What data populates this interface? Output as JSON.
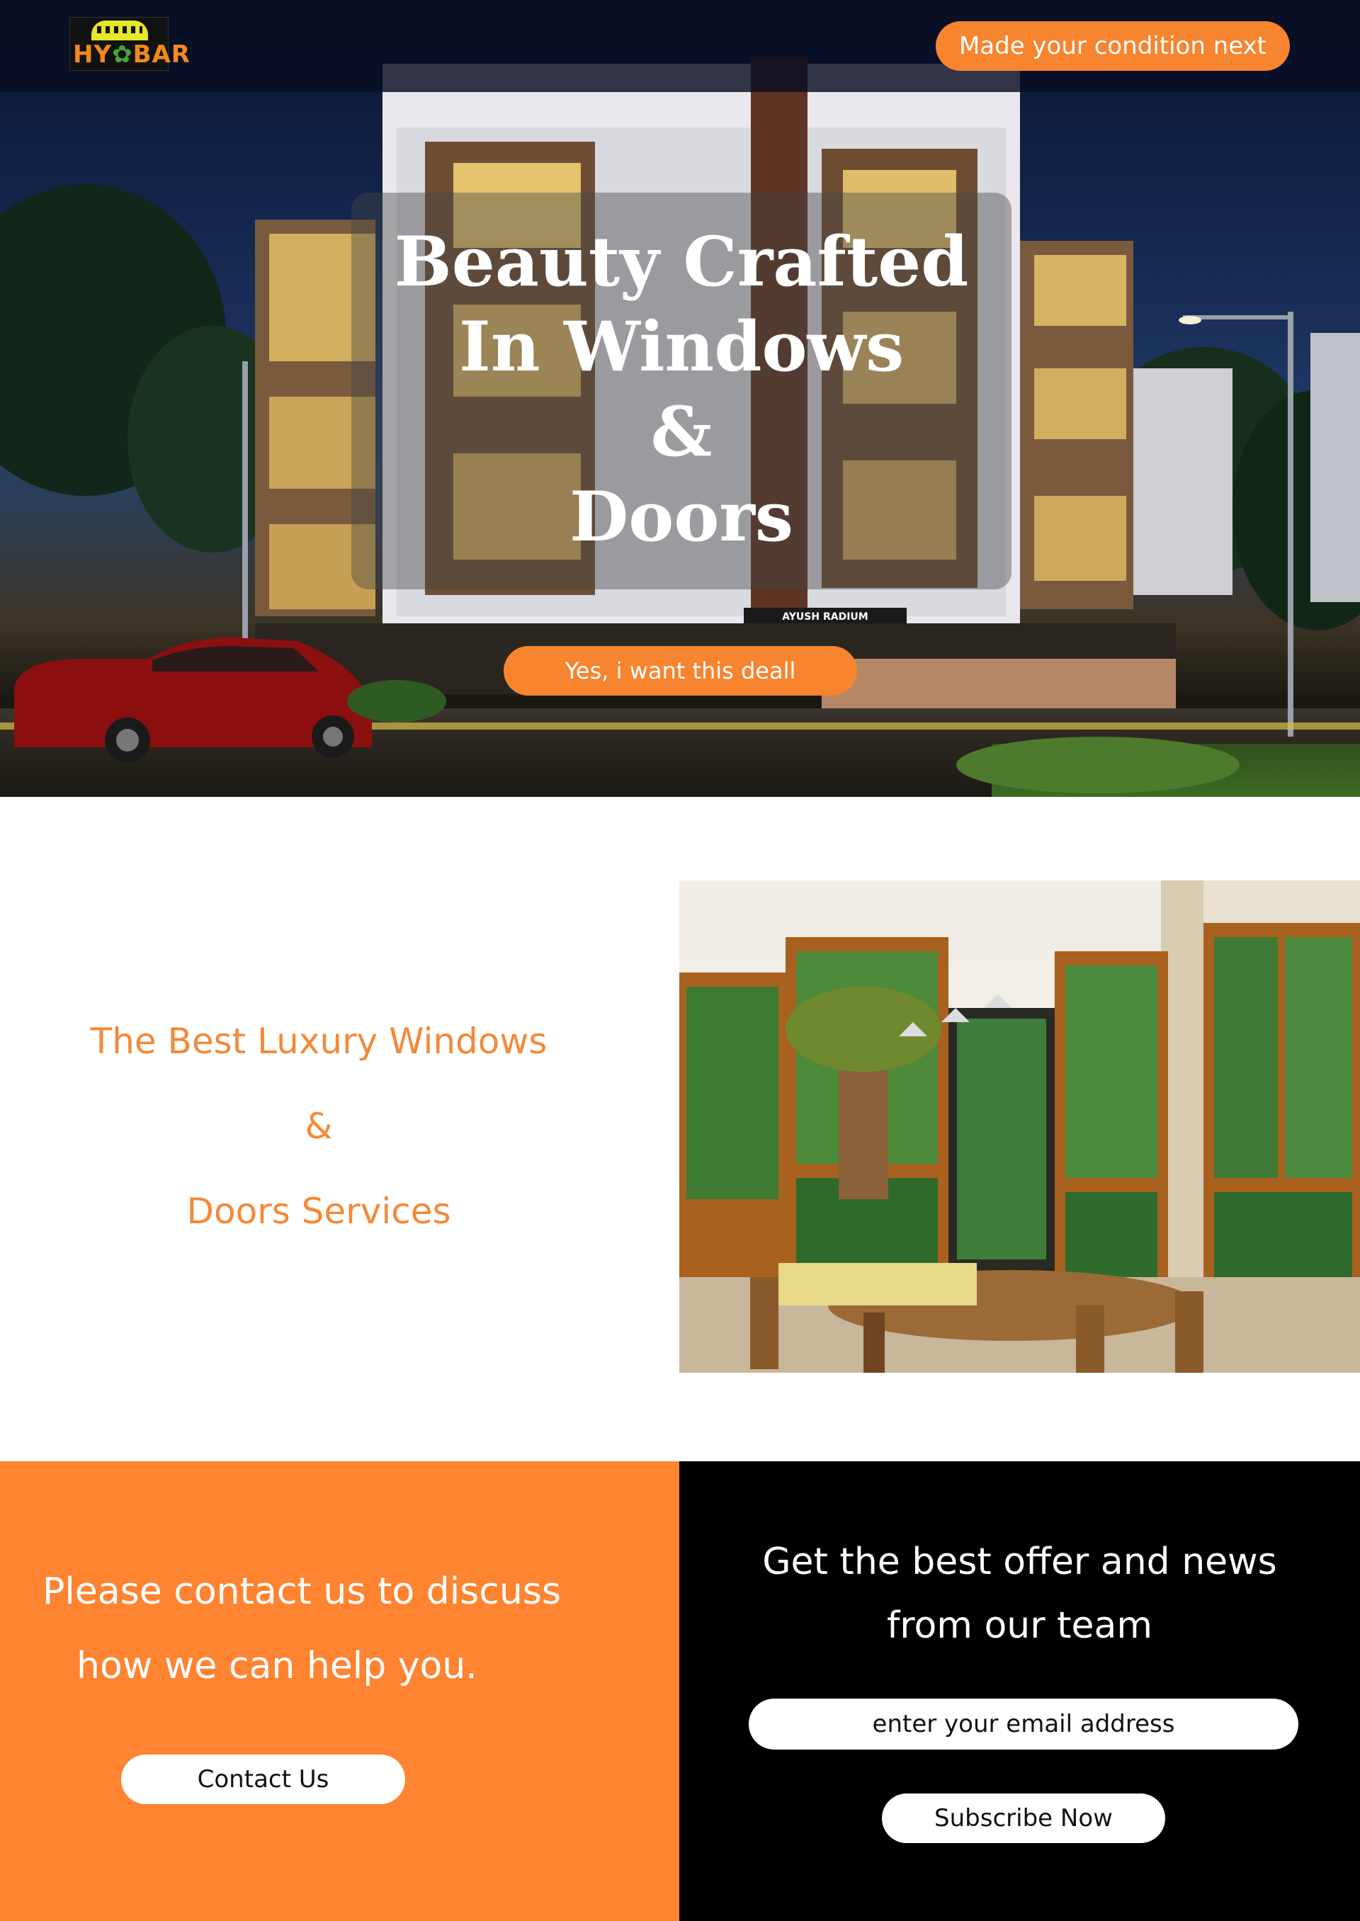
{
  "header": {
    "logo_text_left": "HY",
    "logo_text_right": "BAR",
    "cta_label": "Made your condition next"
  },
  "hero": {
    "title_lines": [
      "Beauty Crafted",
      "In Windows",
      "&",
      "Doors"
    ],
    "building_sign": "AYUSH RADIUM",
    "cta_label": "Yes, i want this deall"
  },
  "feature": {
    "lines": [
      "The Best Luxury Windows",
      "&",
      "Doors Services"
    ]
  },
  "contact": {
    "lines": [
      "Please contact us to discuss",
      "how we can help you."
    ],
    "button_label": "Contact Us"
  },
  "newsletter": {
    "lines": [
      "Get the best offer and news",
      "from our team"
    ],
    "email_placeholder": "enter your email address",
    "button_label": "Subscribe Now"
  },
  "colors": {
    "accent": "#fe8432",
    "feature_text": "#f28a3a",
    "dark_panel": "#000000"
  }
}
